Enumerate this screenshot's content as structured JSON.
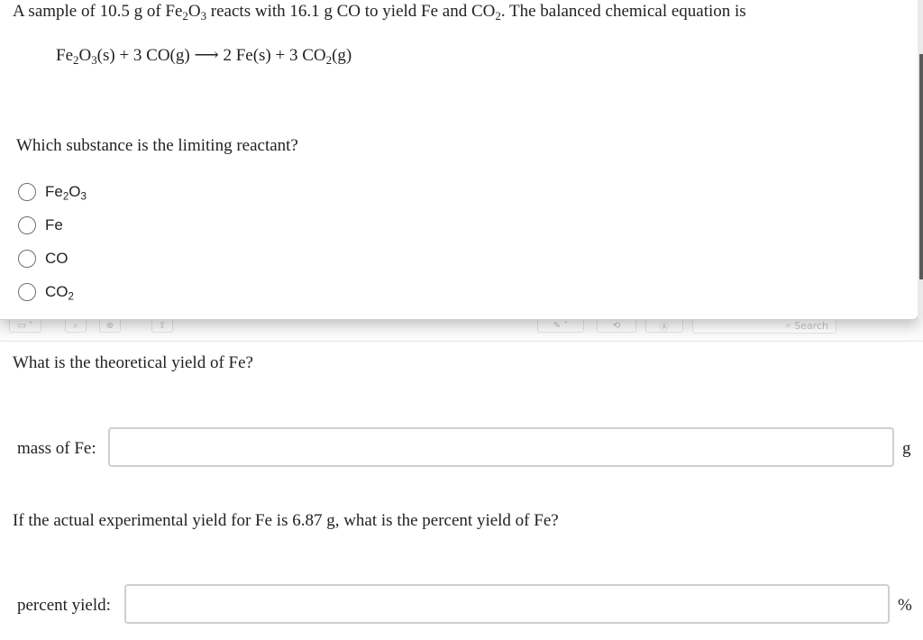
{
  "problem": {
    "intro": "A sample of 10.5 g of Fe",
    "sub1": "2",
    "o": "O",
    "sub2": "3",
    "mid": " reacts with 16.1 g CO to yield Fe and CO",
    "sub3": "2",
    "end": ". The balanced chemical equation is"
  },
  "equation": {
    "t1": "Fe",
    "s1": "2",
    "t2": "O",
    "s2": "3",
    "t3": "(s) + 3 CO(g) ",
    "arrow": "⟶",
    "t4": " 2 Fe(s) + 3 CO",
    "s3": "2",
    "t5": "(g)"
  },
  "question1": "Which substance is the limiting reactant?",
  "options": [
    {
      "main": "Fe",
      "sub": "2",
      "main2": "O",
      "sub2": "3"
    },
    {
      "main": "Fe"
    },
    {
      "main": "CO"
    },
    {
      "main": "CO",
      "sub": "2"
    }
  ],
  "toolbar": {
    "search_placeholder": "Search"
  },
  "question2": "What is the theoretical yield of Fe?",
  "mass_field": {
    "label": "mass of Fe:",
    "value": "",
    "unit": "g"
  },
  "question3": "If the actual experimental yield for Fe is 6.87 g, what is the percent yield of Fe?",
  "percent_field": {
    "label": "percent yield:",
    "value": "",
    "unit": "%"
  }
}
